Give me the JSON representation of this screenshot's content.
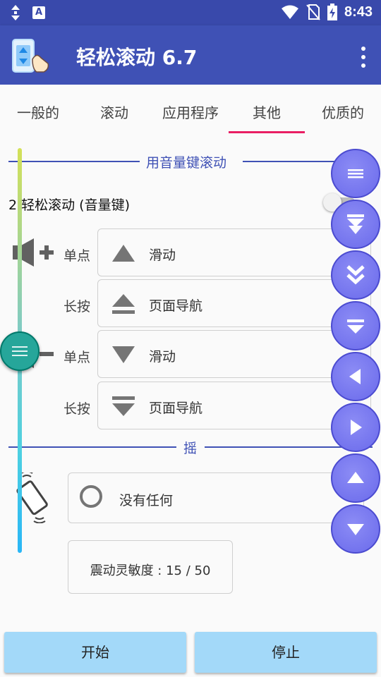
{
  "status_bar": {
    "time": "8:43",
    "a_badge": "A",
    "icons": [
      "updown-arrows-icon",
      "a-badge-icon",
      "wifi-icon",
      "no-sim-icon",
      "battery-charging-icon"
    ]
  },
  "app_bar": {
    "title": "轻松滚动 6.7",
    "logo": "app-logo-icon",
    "menu_icon": "overflow-menu-icon"
  },
  "tabs": [
    {
      "label": "一般的",
      "selected": false
    },
    {
      "label": "滚动",
      "selected": false
    },
    {
      "label": "应用程序",
      "selected": false
    },
    {
      "label": "其他",
      "selected": true
    },
    {
      "label": "优质的",
      "selected": false
    }
  ],
  "volume_section": {
    "header": "用音量键滚动",
    "toggle_label": "2 轻松滚动 (音量键)",
    "toggle_on": false,
    "vol_up": {
      "icon": "volume-plus-icon",
      "single": {
        "label": "单点",
        "icon": "triangle-up-icon",
        "action": "滑动"
      },
      "long": {
        "label": "长按",
        "icon": "page-up-icon",
        "action": "页面导航"
      }
    },
    "vol_down": {
      "icon": "volume-minus-icon",
      "single": {
        "label": "单点",
        "icon": "triangle-down-icon",
        "action": "滑动"
      },
      "long": {
        "label": "长按",
        "icon": "page-down-icon",
        "action": "页面导航"
      }
    }
  },
  "shake_section": {
    "header": "摇",
    "icon": "shake-phone-icon",
    "option": "没有任何",
    "sensitivity": "震动灵敏度 : 15 / 50"
  },
  "floating_buttons": [
    "menu-lines-icon",
    "double-down-arrow-icon",
    "chevron-double-down-icon",
    "scroll-bottom-icon",
    "left-arrow-icon",
    "right-arrow-icon",
    "up-arrow-icon",
    "down-arrow-icon"
  ],
  "bottom": {
    "start": "开始",
    "stop": "停止"
  },
  "colors": {
    "primary": "#3f51b5",
    "status": "#3949ab",
    "accent": "#e91e63",
    "fab": "#7b7bf0",
    "button": "#a3d9f9"
  }
}
